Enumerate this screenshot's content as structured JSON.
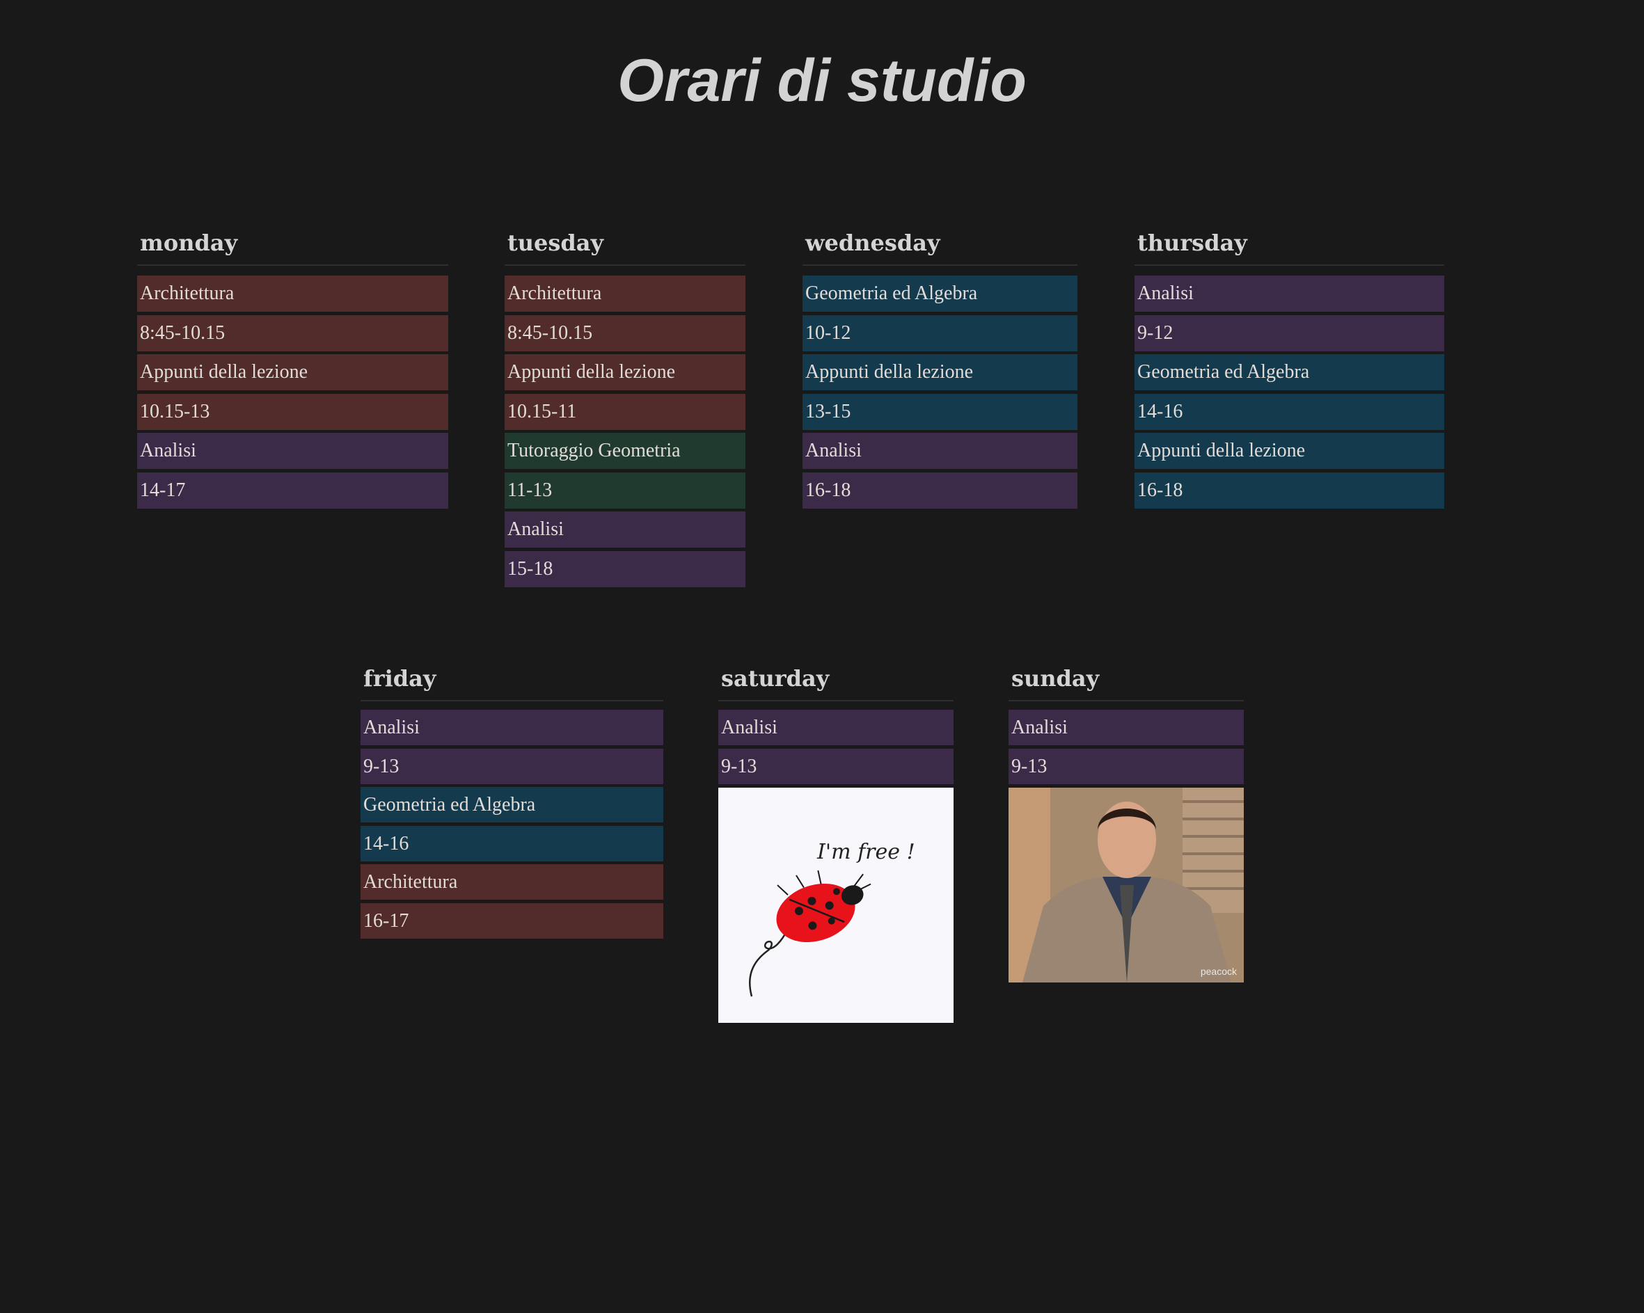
{
  "title": "Orari di studio",
  "days": {
    "monday": {
      "label": "monday",
      "items": [
        "Architettura",
        "8:45-10.15",
        "Appunti della lezione",
        "10.15-13",
        "Analisi",
        "14-17"
      ]
    },
    "tuesday": {
      "label": "tuesday",
      "items": [
        "Architettura",
        "8:45-10.15",
        "Appunti della lezione",
        "10.15-11",
        "Tutoraggio Geometria",
        "11-13",
        "Analisi",
        "15-18"
      ]
    },
    "wednesday": {
      "label": "wednesday",
      "items": [
        "Geometria ed Algebra",
        "10-12",
        "Appunti della lezione",
        "13-15",
        "Analisi",
        "16-18"
      ]
    },
    "thursday": {
      "label": "thursday",
      "items": [
        "Analisi",
        "9-12",
        "Geometria ed Algebra",
        "14-16",
        "Appunti della lezione",
        "16-18"
      ]
    },
    "friday": {
      "label": "friday",
      "items": [
        "Analisi",
        "9-13",
        "Geometria ed Algebra",
        "14-16",
        "Architettura",
        "16-17"
      ]
    },
    "saturday": {
      "label": "saturday",
      "items": [
        "Analisi",
        "9-13"
      ],
      "image_caption": "I'm free !"
    },
    "sunday": {
      "label": "sunday",
      "items": [
        "Analisi",
        "9-13"
      ],
      "image_watermark": "peacock"
    }
  },
  "colors": {
    "background": "#191919",
    "architettura": "#522c2a",
    "analisi": "#3c2b48",
    "geometria": "#143a4e",
    "tutoraggio": "#213a2f"
  }
}
